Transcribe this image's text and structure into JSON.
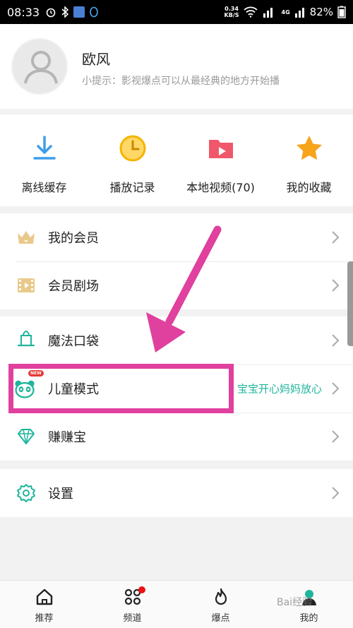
{
  "status_bar": {
    "time": "08:33",
    "speed_value": "0.34",
    "speed_unit": "KB/S",
    "signal_1": "1",
    "network": "4G",
    "signal_2": "1",
    "battery": "82%"
  },
  "profile": {
    "name": "欧风",
    "tip": "小提示：影视爆点可以从最经典的地方开始播"
  },
  "quick_actions": [
    {
      "label": "离线缓存",
      "icon": "download-icon",
      "color": "#3d9ee8"
    },
    {
      "label": "播放记录",
      "icon": "clock-icon",
      "color": "#f4b400"
    },
    {
      "label": "本地视频(70)",
      "icon": "video-folder-icon",
      "color": "#f0576a"
    },
    {
      "label": "我的收藏",
      "icon": "star-icon",
      "color": "#f7a31c"
    }
  ],
  "menu": {
    "vip": {
      "label": "我的会员",
      "icon": "crown-icon"
    },
    "vip_theater": {
      "label": "会员剧场",
      "icon": "film-icon"
    },
    "magic_pocket": {
      "label": "魔法口袋",
      "icon": "magic-hat-icon"
    },
    "kids_mode": {
      "label": "儿童模式",
      "subtitle": "宝宝开心妈妈放心",
      "badge": "NEW",
      "icon": "panda-icon"
    },
    "earn": {
      "label": "赚赚宝",
      "icon": "diamond-icon"
    },
    "settings": {
      "label": "设置",
      "icon": "gear-icon"
    }
  },
  "bottom_nav": [
    {
      "label": "推荐",
      "icon": "home-icon"
    },
    {
      "label": "频道",
      "icon": "channels-icon"
    },
    {
      "label": "爆点",
      "icon": "flame-icon"
    },
    {
      "label": "我的",
      "icon": "profile-icon"
    }
  ],
  "watermark": "Bai经验",
  "colors": {
    "accent": "#1fb59c",
    "annotation": "#e0409e"
  }
}
